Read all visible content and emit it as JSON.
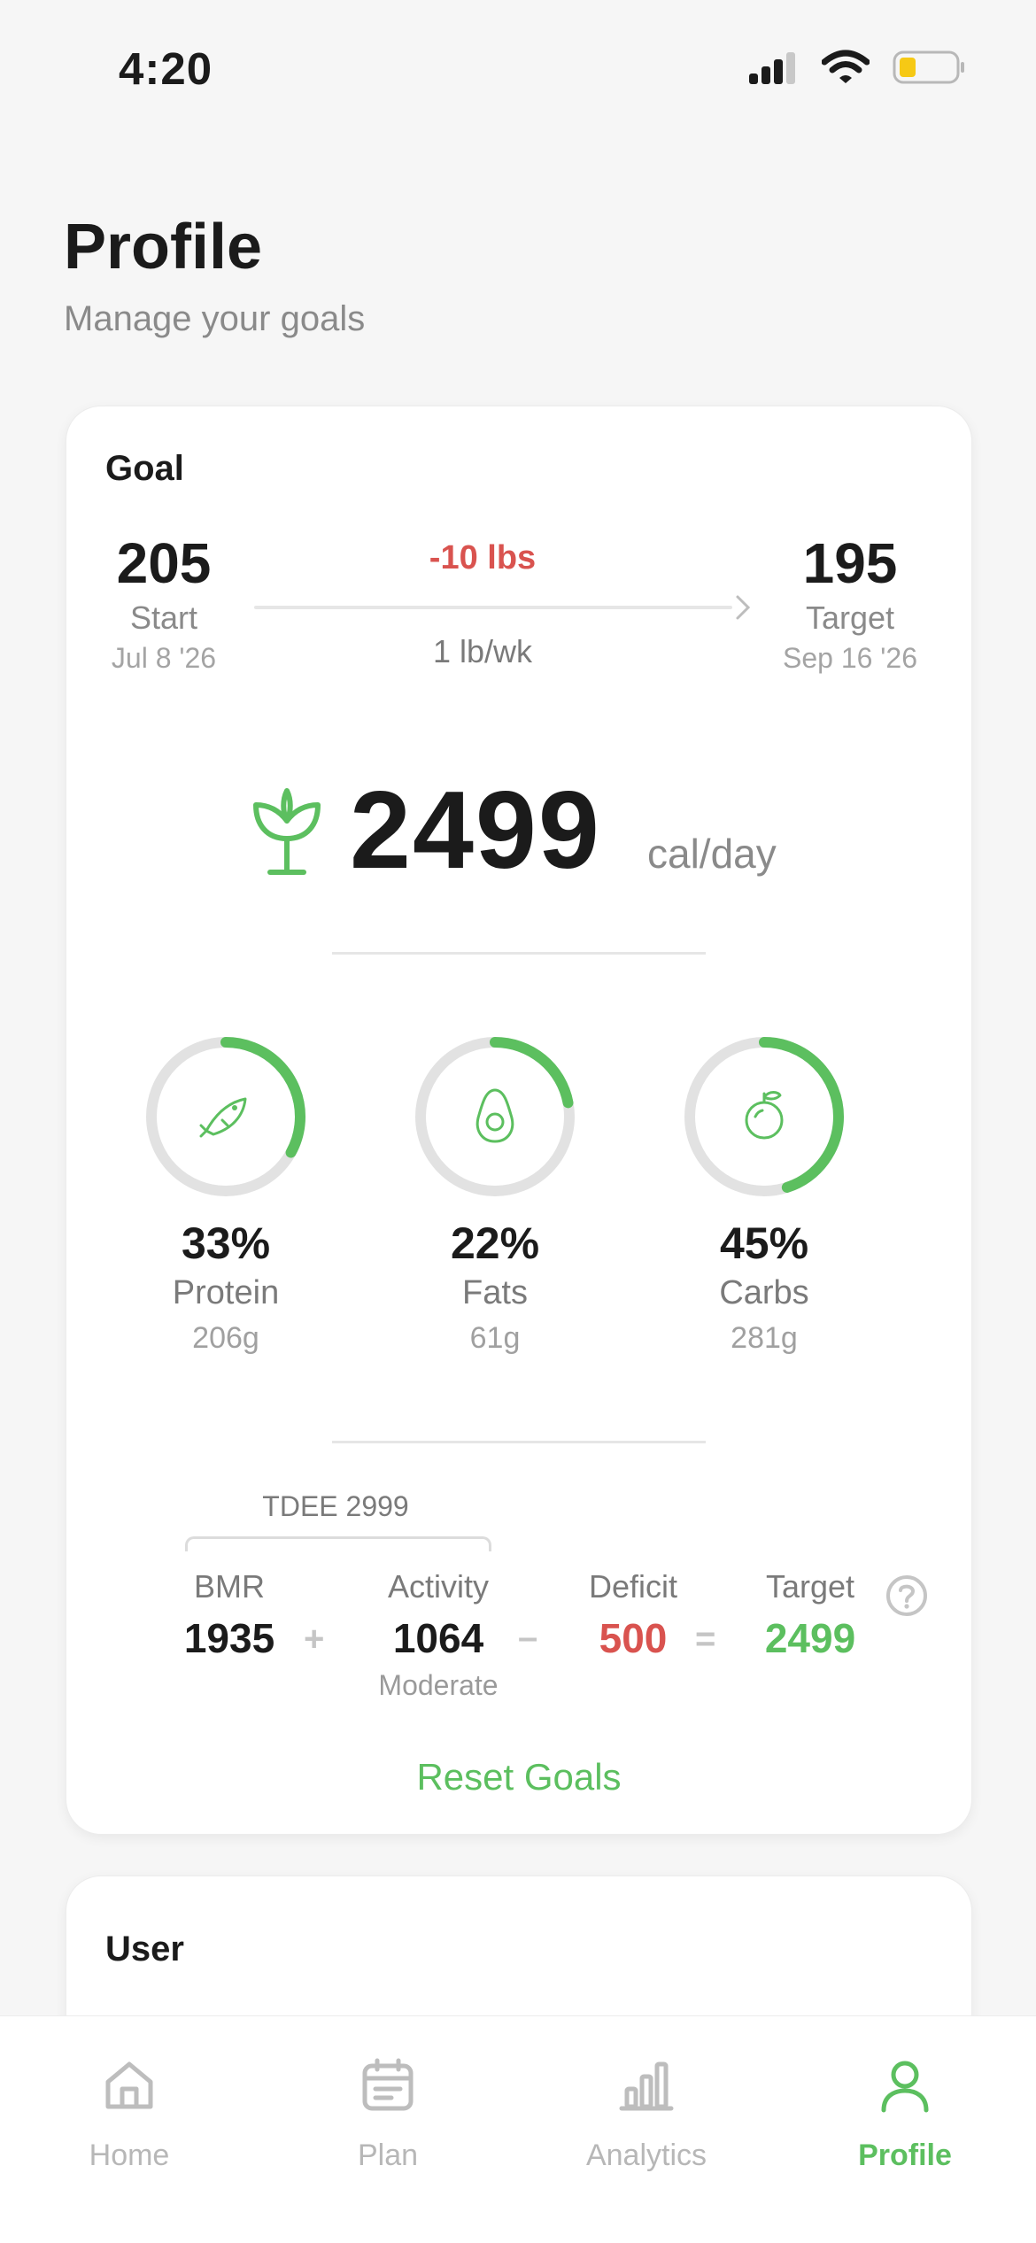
{
  "status_bar": {
    "time": "4:20"
  },
  "header": {
    "title": "Profile",
    "subtitle": "Manage your goals"
  },
  "goal_card": {
    "title": "Goal",
    "start": {
      "weight": "205",
      "label": "Start",
      "date": "Jul 8 '26"
    },
    "target": {
      "weight": "195",
      "label": "Target",
      "date": "Sep 16 '26"
    },
    "change": "-10 lbs",
    "rate": "1 lb/wk",
    "calories": {
      "value": "2499",
      "unit": "cal/day",
      "icon": "sprout-icon"
    },
    "macros": [
      {
        "pct": "33%",
        "name": "Protein",
        "grams": "206g",
        "fraction": 0.33,
        "icon": "fish-icon"
      },
      {
        "pct": "22%",
        "name": "Fats",
        "grams": "61g",
        "fraction": 0.22,
        "icon": "avocado-icon"
      },
      {
        "pct": "45%",
        "name": "Carbs",
        "grams": "281g",
        "fraction": 0.45,
        "icon": "fruit-icon"
      }
    ],
    "tdee_label": "TDEE 2999",
    "equation": {
      "bmr": {
        "label": "BMR",
        "value": "1935"
      },
      "activity": {
        "label": "Activity",
        "value": "1064",
        "sub": "Moderate"
      },
      "deficit": {
        "label": "Deficit",
        "value": "500"
      },
      "target": {
        "label": "Target",
        "value": "2499"
      },
      "plus": "+",
      "minus": "–",
      "equals": "="
    },
    "reset_label": "Reset Goals"
  },
  "user_card": {
    "title": "User"
  },
  "tabbar": {
    "items": [
      {
        "label": "Home",
        "icon": "home-icon"
      },
      {
        "label": "Plan",
        "icon": "calendar-icon"
      },
      {
        "label": "Analytics",
        "icon": "bar-chart-icon"
      },
      {
        "label": "Profile",
        "icon": "person-icon"
      }
    ],
    "active": "Profile"
  },
  "colors": {
    "accent": "#5cbf5f",
    "danger": "#d9534f",
    "ring_track": "#e2e2e2"
  }
}
